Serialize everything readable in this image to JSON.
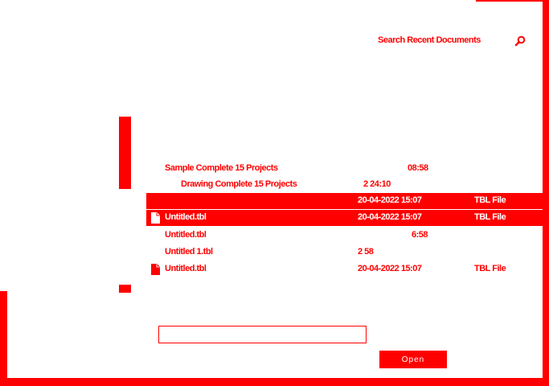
{
  "search": {
    "label": "Search Recent Documents",
    "icon": "search-icon"
  },
  "files": [
    {
      "name": "Sample Complete 15 Projects",
      "date": "08:58",
      "type": "",
      "indent": false,
      "selected": false,
      "icon": ""
    },
    {
      "name": "Drawing Complete 15 Projects",
      "date": "2    24:10",
      "type": "",
      "indent": true,
      "selected": false,
      "icon": ""
    },
    {
      "name": "",
      "date": "20-04-2022 15:07",
      "type": "TBL File",
      "indent": false,
      "selected": true,
      "icon": ""
    },
    {
      "name": "Untitled.tbl",
      "date": "20-04-2022 15:07",
      "type": "TBL File",
      "indent": false,
      "selected": true,
      "icon": "file-icon"
    },
    {
      "name": "Untitled.tbl",
      "date": "6:58",
      "type": "",
      "indent": false,
      "selected": false,
      "icon": ""
    },
    {
      "name": "Untitled 1.tbl",
      "date": "2    58",
      "type": "",
      "indent": false,
      "selected": false,
      "icon": ""
    },
    {
      "name": "Untitled.tbl",
      "date": "20-04-2022 15:07",
      "type": "TBL File",
      "indent": false,
      "selected": false,
      "icon": "file-icon"
    }
  ],
  "filename": {
    "value": "",
    "placeholder": ""
  },
  "open_button": {
    "label": "Open"
  },
  "colors": {
    "accent": "#ff0000",
    "background": "#ffffff"
  }
}
